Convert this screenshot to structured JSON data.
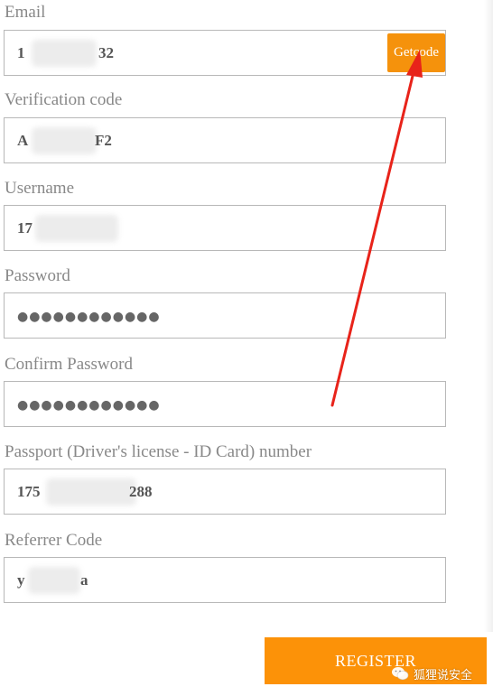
{
  "form": {
    "email": {
      "label": "Email",
      "value_prefix": "1",
      "value_suffix": "32"
    },
    "get_code_label": "Getcode",
    "verification": {
      "label": "Verification code",
      "value_prefix": "A",
      "value_suffix": "F2"
    },
    "username": {
      "label": "Username",
      "value_prefix": "17"
    },
    "password": {
      "label": "Password",
      "value": "●●●●●●●●●●●●"
    },
    "confirm_password": {
      "label": "Confirm Password",
      "value": "●●●●●●●●●●●●"
    },
    "passport": {
      "label": "Passport (Driver's license - ID Card) number",
      "value_prefix": "175",
      "value_suffix": "288"
    },
    "referrer": {
      "label": "Referrer Code",
      "value_prefix": "y",
      "value_suffix": "a"
    },
    "register_label": "REGISTER"
  },
  "watermark": {
    "icon": "wechat-icon",
    "text": "狐狸说安全"
  },
  "annotation": {
    "icon": "red-arrow-icon",
    "color": "#e8231a"
  },
  "colors": {
    "accent": "#f5920c",
    "label": "#888888",
    "border": "#b8b8b8"
  }
}
